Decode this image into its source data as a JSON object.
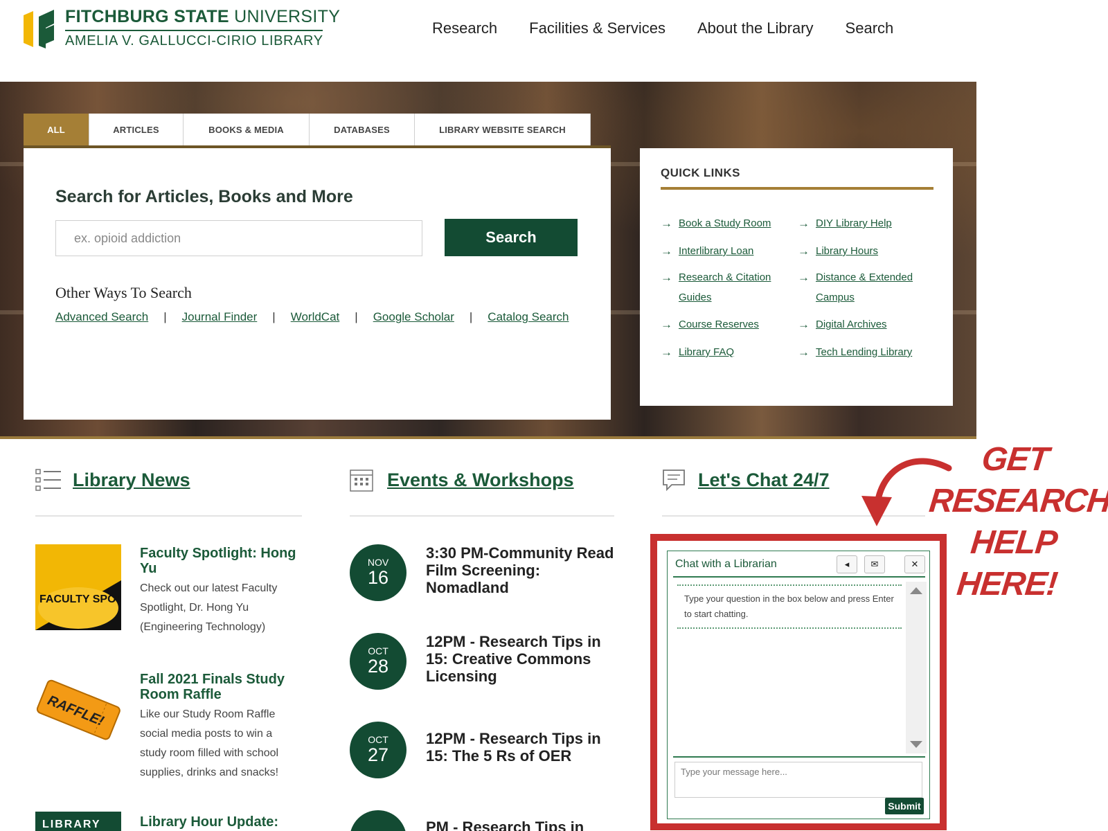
{
  "header": {
    "university": "FITCHBURG STATE",
    "university_suffix": "UNIVERSITY",
    "library": "AMELIA V. GALLUCCI-CIRIO LIBRARY",
    "nav": [
      "Research",
      "Facilities & Services",
      "About the Library",
      "Search"
    ]
  },
  "search": {
    "tabs": [
      "ALL",
      "ARTICLES",
      "BOOKS & MEDIA",
      "DATABASES",
      "LIBRARY WEBSITE SEARCH"
    ],
    "active_tab": "ALL",
    "title": "Search for Articles, Books and More",
    "placeholder": "ex. opioid addiction",
    "button": "Search",
    "other_title": "Other Ways To Search",
    "other_links": [
      "Advanced Search",
      "Journal Finder",
      "WorldCat",
      "Google Scholar",
      "Catalog Search"
    ],
    "separator": "|"
  },
  "quick_links": {
    "title": "QUICK LINKS",
    "arrow": "→",
    "col1": [
      "Book a Study Room",
      "Interlibrary Loan",
      "Research & Citation Guides",
      "Course Reserves",
      "Library FAQ"
    ],
    "col2": [
      "DIY Library Help",
      "Library Hours",
      "Distance & Extended Campus",
      "Digital Archives",
      "Tech Lending Library"
    ]
  },
  "news": {
    "heading": "Library News",
    "items": [
      {
        "title": "Faculty Spotlight: Hong Yu",
        "body": "Check out our latest Faculty Spotlight, Dr. Hong Yu (Engineering Technology)",
        "thumb_text": "FACULTY SPOTLIGHT"
      },
      {
        "title": "Fall 2021 Finals Study Room Raffle",
        "body": "Like our Study Room Raffle social media posts to win a study room filled with school supplies, drinks and snacks!",
        "thumb_text": "RAFFLE!"
      },
      {
        "title": "Library Hour Update:",
        "thumb_text": "LIBRARY"
      }
    ]
  },
  "events": {
    "heading": "Events & Workshops",
    "items": [
      {
        "month": "NOV",
        "day": "16",
        "title": "3:30 PM-Community Read Film Screening: Nomadland"
      },
      {
        "month": "OCT",
        "day": "28",
        "title": "12PM - Research Tips in 15: Creative Commons Licensing"
      },
      {
        "month": "OCT",
        "day": "27",
        "title": "12PM - Research Tips in 15: The 5 Rs of OER"
      },
      {
        "month": "",
        "day": "",
        "title": "PM - Research Tips in"
      }
    ]
  },
  "chat": {
    "heading": "Let's Chat 24/7",
    "widget_title": "Chat with a Librarian",
    "intro": "Type your question in the box below and press Enter to start chatting.",
    "input_placeholder": "Type your message here...",
    "submit": "Submit",
    "tools": [
      "sound-icon",
      "email-icon",
      "close-icon"
    ],
    "callout": [
      "GET",
      "RESEARCH",
      "HELP",
      "HERE!"
    ]
  },
  "colors": {
    "brand_green": "#134b33",
    "link_green": "#1b5a39",
    "gold": "#a57f36",
    "callout_red": "#c8302f",
    "logo_yellow": "#f2b705"
  }
}
